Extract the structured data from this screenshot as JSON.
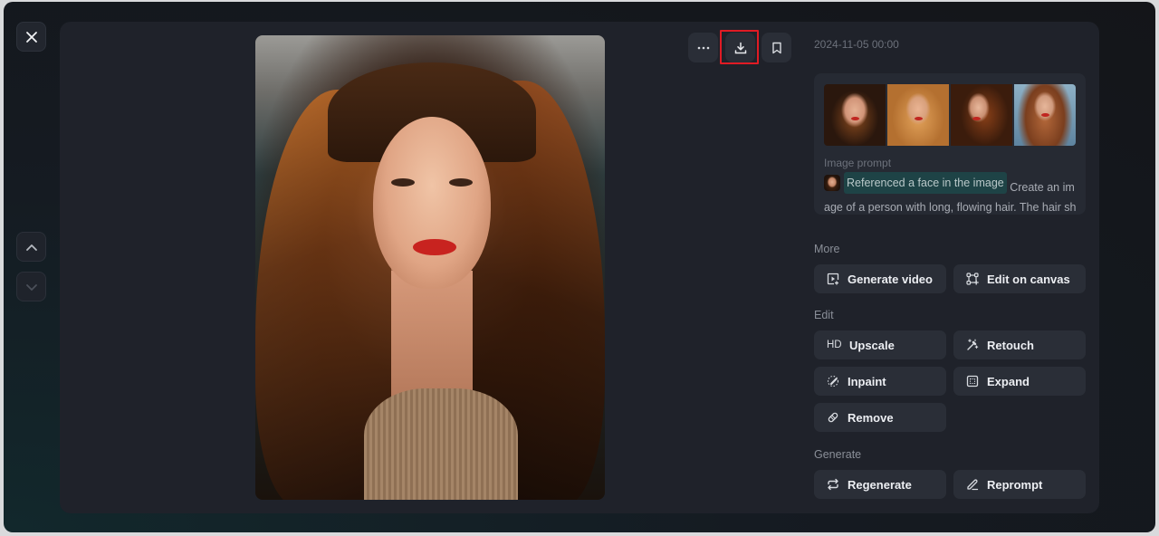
{
  "window": {
    "close_label": "Close viewer",
    "nav_up_label": "Previous",
    "nav_down_label": "Next"
  },
  "toolbar": {
    "more_label": "More options",
    "download_label": "Download",
    "bookmark_label": "Bookmark"
  },
  "details": {
    "timestamp": "2024-11-05 00:00",
    "thumbnails": [
      "Generated image 1",
      "Generated image 2",
      "Generated image 3",
      "Generated image 4"
    ],
    "prompt_label": "Image prompt",
    "reference_chip": "Referenced a face in the image",
    "prompt_text": "Create an image of a person with long, flowing hair. The hair sho"
  },
  "sections": {
    "more": {
      "label": "More",
      "buttons": [
        {
          "label": "Generate video",
          "icon": "video-plus-icon"
        },
        {
          "label": "Edit on canvas",
          "icon": "canvas-icon"
        }
      ]
    },
    "edit": {
      "label": "Edit",
      "buttons": [
        {
          "label": "Upscale",
          "icon": "hd-icon",
          "prefix": "HD"
        },
        {
          "label": "Retouch",
          "icon": "magic-wand-icon"
        },
        {
          "label": "Inpaint",
          "icon": "brush-icon"
        },
        {
          "label": "Expand",
          "icon": "expand-icon"
        },
        {
          "label": "Remove",
          "icon": "eraser-icon"
        }
      ]
    },
    "generate": {
      "label": "Generate",
      "buttons": [
        {
          "label": "Regenerate",
          "icon": "repeat-icon"
        },
        {
          "label": "Reprompt",
          "icon": "pencil-icon"
        }
      ]
    }
  },
  "colors": {
    "highlight": "#e01b24",
    "chip_bg": "#1e4346",
    "panel_bg": "#1f222a",
    "button_bg": "#2a2e37"
  }
}
